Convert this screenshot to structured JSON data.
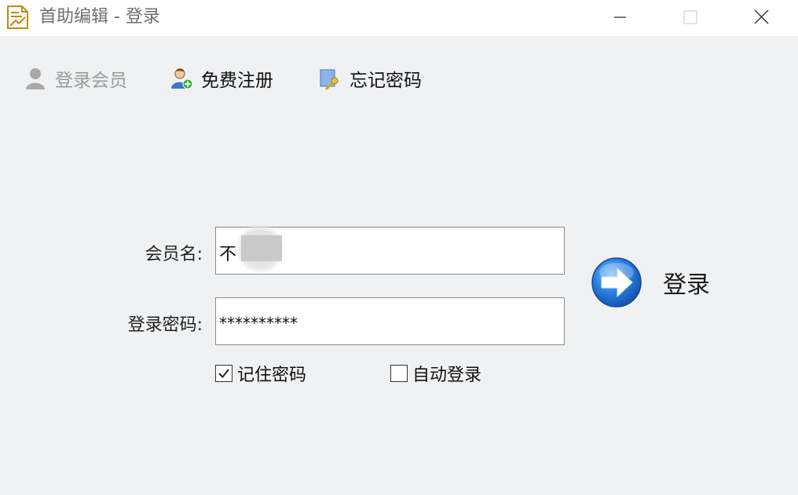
{
  "window": {
    "title": "首助编辑 - 登录"
  },
  "toolbar": {
    "login_member": "登录会员",
    "register": "免费注册",
    "forgot_password": "忘记密码"
  },
  "form": {
    "member_label": "会员名:",
    "member_value": "不",
    "password_label": "登录密码:",
    "password_value": "**********",
    "remember_label": "记住密码",
    "remember_checked": true,
    "auto_login_label": "自动登录",
    "auto_login_checked": false,
    "login_button": "登录"
  },
  "colors": {
    "accent": "#1e73d8",
    "window_bg": "#f0f1f3"
  }
}
